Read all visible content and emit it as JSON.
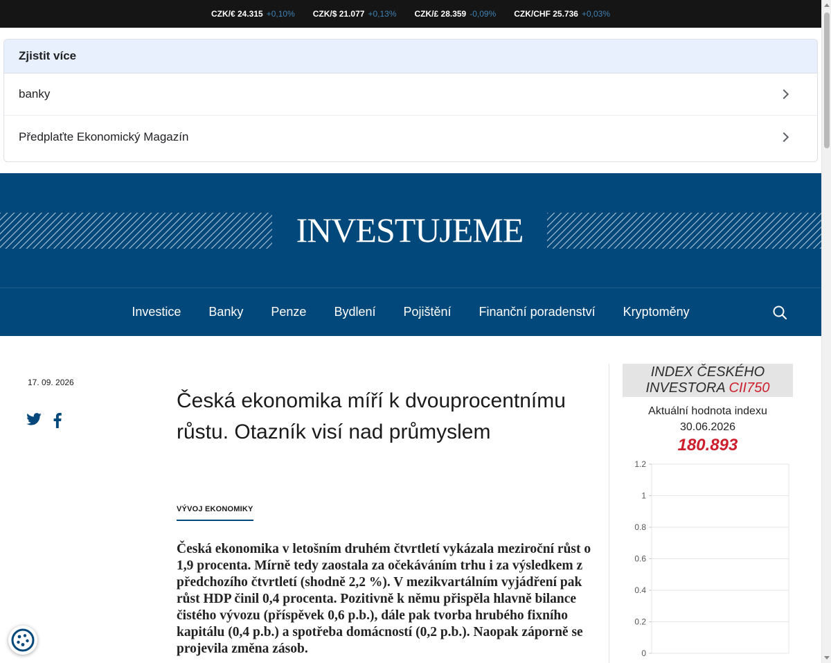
{
  "ticker": [
    {
      "label": "CZK/€ 24.315",
      "change": "+0,10%"
    },
    {
      "label": "CZK/$ 21.077",
      "change": "+0,13%"
    },
    {
      "label": "CZK/£ 28.359",
      "change": "-0,09%"
    },
    {
      "label": "CZK/CHF 25.736",
      "change": "+0,03%"
    }
  ],
  "learn_more": {
    "title": "Zjistit více",
    "items": [
      "banky",
      "Předplaťte Ekonomický Magazín"
    ]
  },
  "masthead": {
    "logo": "INVESTUJEME"
  },
  "nav": {
    "items": [
      "Investice",
      "Banky",
      "Penze",
      "Bydlení",
      "Pojištění",
      "Finanční poradenství",
      "Kryptoměny"
    ]
  },
  "article": {
    "date": "17. 09. 2026",
    "title": "Česká ekonomika míří k dvouprocentnímu růstu. Otazník visí nad průmyslem",
    "category": "VÝVOJ EKONOMIKY",
    "lead": "Česká ekonomika v letošním druhém čtvrtletí vykázala meziroční růst o 1,9 procenta. Mírně tedy zaostala za očekáváním trhu i za výsledkem z předchozího čtvrtletí (shodně 2,2 %). V mezikvartálním vyjádření pak růst HDP činil 0,4 procenta. Pozitivně k němu přispěla hlavně bilance čistého vývozu (příspěvek 0,6 p.b.), dále pak tvorba hrubého fixního kapitálu (0,4 p.b.) a spotřeba domácností (0,2 p.b.). Naopak záporně se projevila změna zásob."
  },
  "index_widget": {
    "title_line1": "INDEX ČESKÉHO",
    "title_line2": "INVESTORA",
    "title_accent": "CII750",
    "subtitle": "Aktuální hodnota indexu",
    "date": "30.06.2026",
    "value": "180.893"
  },
  "chart_data": {
    "type": "line",
    "x": [],
    "series": [],
    "ylim": [
      0,
      1.2
    ],
    "yticks": [
      "0",
      "0.2",
      "0.4",
      "0.6",
      "0.8",
      "1",
      "1.2"
    ],
    "grid": true
  },
  "colors": {
    "brand": "#03487a",
    "accent": "#cc1e2d",
    "ticker_bg": "#151515",
    "ticker_change": "#3f82b5"
  }
}
